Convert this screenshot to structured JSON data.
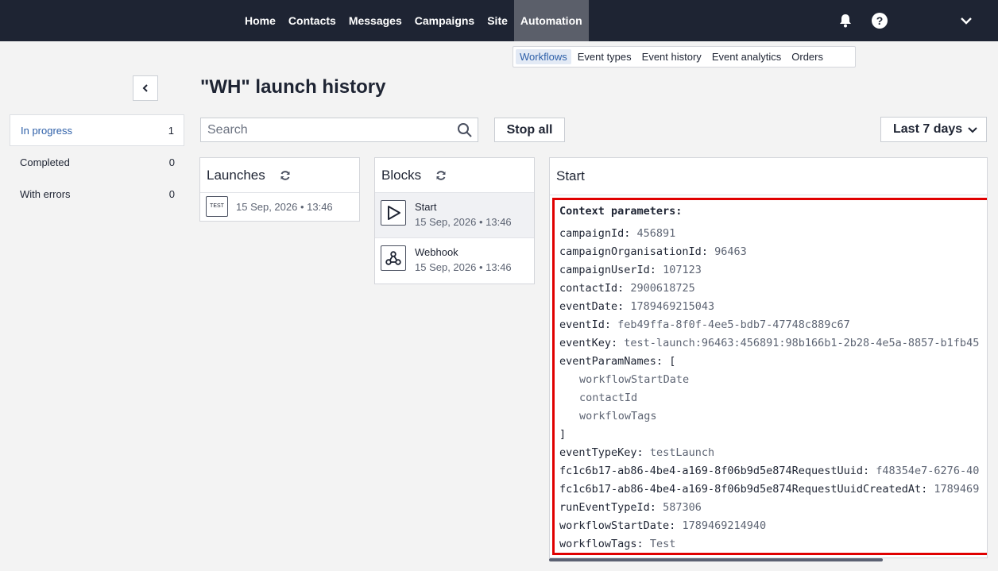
{
  "nav": {
    "items": [
      "Home",
      "Contacts",
      "Messages",
      "Campaigns",
      "Site",
      "Automation"
    ],
    "active": "Automation"
  },
  "subnav": {
    "items": [
      "Workflows",
      "Event types",
      "Event history",
      "Event analytics",
      "Orders"
    ],
    "active": "Workflows"
  },
  "page": {
    "title": "\"WH\" launch history"
  },
  "filters": [
    {
      "label": "In progress",
      "count": "1"
    },
    {
      "label": "Completed",
      "count": "0"
    },
    {
      "label": "With errors",
      "count": "0"
    }
  ],
  "search": {
    "placeholder": "Search"
  },
  "buttons": {
    "stop_all": "Stop all",
    "period": "Last 7 days"
  },
  "launches": {
    "title": "Launches",
    "items": [
      {
        "badge": "TEST",
        "time": "15 Sep, 2026 • 13:46"
      }
    ]
  },
  "blocks": {
    "title": "Blocks",
    "items": [
      {
        "name": "Start",
        "time": "15 Sep, 2026 • 13:46",
        "icon": "play-icon"
      },
      {
        "name": "Webhook",
        "time": "15 Sep, 2026 • 13:46",
        "icon": "webhook-icon"
      }
    ]
  },
  "detail": {
    "title": "Start",
    "context_header": "Context parameters:",
    "params": [
      {
        "key": "campaignId",
        "value": "456891"
      },
      {
        "key": "campaignOrganisationId",
        "value": "96463"
      },
      {
        "key": "campaignUserId",
        "value": "107123"
      },
      {
        "key": "contactId",
        "value": "2900618725"
      },
      {
        "key": "eventDate",
        "value": "1789469215043"
      },
      {
        "key": "eventId",
        "value": "feb49ffa-8f0f-4ee5-bdb7-47748c889c67"
      },
      {
        "key": "eventKey",
        "value": "test-launch:96463:456891:98b166b1-2b28-4e5a-8857-b1fb45"
      },
      {
        "key": "eventParamNames",
        "value": "["
      },
      {
        "key": "",
        "value": "workflowStartDate",
        "indent": true
      },
      {
        "key": "",
        "value": "contactId",
        "indent": true
      },
      {
        "key": "",
        "value": "workflowTags",
        "indent": true
      },
      {
        "key": "",
        "value": "]",
        "bracket": true
      },
      {
        "key": "eventTypeKey",
        "value": "testLaunch"
      },
      {
        "key": "fc1c6b17-ab86-4be4-a169-8f06b9d5e874RequestUuid",
        "value": "f48354e7-6276-40"
      },
      {
        "key": "fc1c6b17-ab86-4be4-a169-8f06b9d5e874RequestUuidCreatedAt",
        "value": "1789469"
      },
      {
        "key": "runEventTypeId",
        "value": "587306"
      },
      {
        "key": "workflowStartDate",
        "value": "1789469214940"
      },
      {
        "key": "workflowTags",
        "value": "Test"
      }
    ]
  }
}
